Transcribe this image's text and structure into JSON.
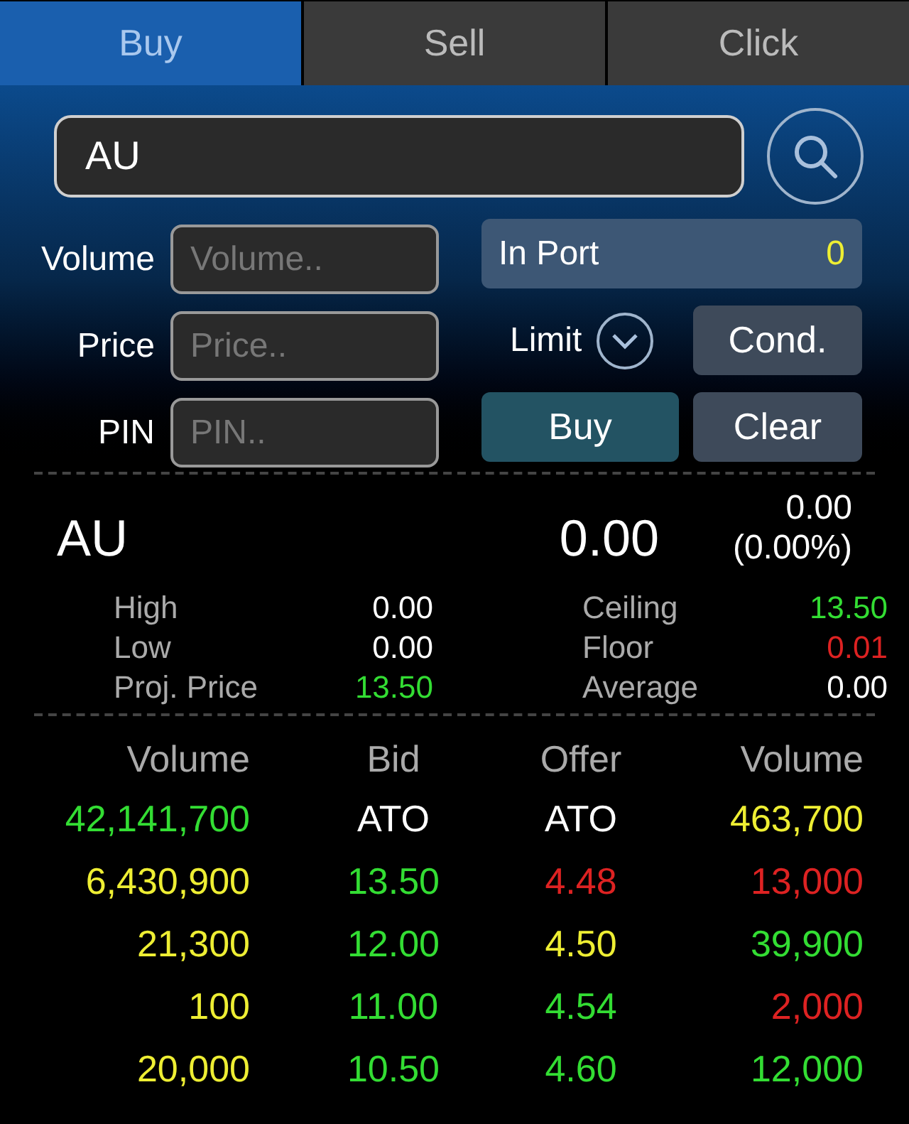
{
  "tabs": [
    {
      "label": "Buy",
      "selected": true
    },
    {
      "label": "Sell",
      "selected": false
    },
    {
      "label": "Click",
      "selected": false
    }
  ],
  "symbol_field": {
    "value": "AU"
  },
  "form": {
    "fields": [
      {
        "label": "Volume",
        "placeholder": "Volume.."
      },
      {
        "label": "Price",
        "placeholder": "Price.."
      },
      {
        "label": "PIN",
        "placeholder": "PIN.."
      }
    ],
    "in_port": {
      "label": "In Port",
      "value": "0"
    },
    "order_type": {
      "label": "Limit"
    },
    "cond_button": "Cond.",
    "buy_button": "Buy",
    "clear_button": "Clear"
  },
  "quote": {
    "symbol": "AU",
    "last": "0.00",
    "change": "0.00",
    "change_pct": "(0.00%)",
    "stats": [
      {
        "label": "High",
        "value": "0.00",
        "color": "#ffffff"
      },
      {
        "label": "Ceiling",
        "value": "13.50",
        "color": "#33dd33"
      },
      {
        "label": "Low",
        "value": "0.00",
        "color": "#ffffff"
      },
      {
        "label": "Floor",
        "value": "0.01",
        "color": "#dd2222"
      },
      {
        "label": "Proj. Price",
        "value": "13.50",
        "color": "#33dd33"
      },
      {
        "label": "Average",
        "value": "0.00",
        "color": "#ffffff"
      }
    ]
  },
  "order_book": {
    "columns": [
      "Volume",
      "Bid",
      "Offer",
      "Volume"
    ],
    "rows": [
      {
        "cells": [
          {
            "text": "42,141,700",
            "color": "#33dd33"
          },
          {
            "text": "ATO",
            "color": "#ffffff"
          },
          {
            "text": "ATO",
            "color": "#ffffff"
          },
          {
            "text": "463,700",
            "color": "#eeee33"
          }
        ]
      },
      {
        "cells": [
          {
            "text": "6,430,900",
            "color": "#eeee33"
          },
          {
            "text": "13.50",
            "color": "#33dd33"
          },
          {
            "text": "4.48",
            "color": "#dd2222"
          },
          {
            "text": "13,000",
            "color": "#dd2222"
          }
        ]
      },
      {
        "cells": [
          {
            "text": "21,300",
            "color": "#eeee33"
          },
          {
            "text": "12.00",
            "color": "#33dd33"
          },
          {
            "text": "4.50",
            "color": "#eeee33"
          },
          {
            "text": "39,900",
            "color": "#33dd33"
          }
        ]
      },
      {
        "cells": [
          {
            "text": "100",
            "color": "#eeee33"
          },
          {
            "text": "11.00",
            "color": "#33dd33"
          },
          {
            "text": "4.54",
            "color": "#33dd33"
          },
          {
            "text": "2,000",
            "color": "#dd2222"
          }
        ]
      },
      {
        "cells": [
          {
            "text": "20,000",
            "color": "#eeee33"
          },
          {
            "text": "10.50",
            "color": "#33dd33"
          },
          {
            "text": "4.60",
            "color": "#33dd33"
          },
          {
            "text": "12,000",
            "color": "#33dd33"
          }
        ]
      }
    ]
  }
}
